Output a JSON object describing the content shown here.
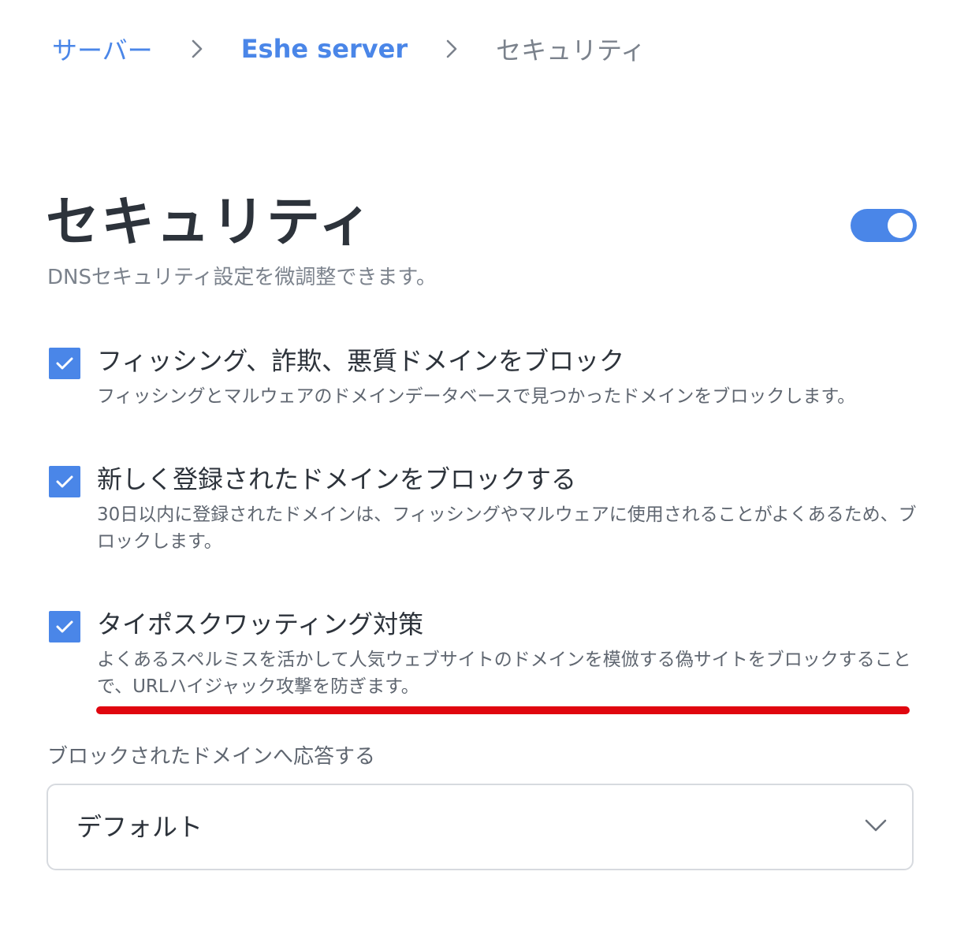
{
  "breadcrumb": {
    "items": [
      "サーバー",
      "Eshe server"
    ],
    "current": "セキュリティ",
    "separator_icon": "chevron-right-icon"
  },
  "header": {
    "title": "セキュリティ",
    "subtitle": "DNSセキュリティ設定を微調整できます。",
    "toggle_enabled": true
  },
  "options": [
    {
      "checked": true,
      "title": "フィッシング、詐欺、悪質ドメインをブロック",
      "description": "フィッシングとマルウェアのドメインデータベースで見つかったドメインをブロックします。"
    },
    {
      "checked": true,
      "title": "新しく登録されたドメインをブロックする",
      "description": "30日以内に登録されたドメインは、フィッシングやマルウェアに使用されることがよくあるため、ブロックします。"
    },
    {
      "checked": true,
      "title": "タイポスクワッティング対策",
      "description": "よくあるスペルミスを活かして人気ウェブサイトのドメインを模倣する偽サイトをブロックすることで、URLハイジャック攻撃を防ぎます。"
    }
  ],
  "response": {
    "label": "ブロックされたドメインへ応答する",
    "selected": "デフォルト",
    "icon": "chevron-down-icon"
  },
  "colors": {
    "accent": "#4a86e8",
    "title_text": "#2d333b",
    "muted_text": "#7b828c",
    "highlight_underline": "#e0060f",
    "border": "#d7dadf"
  }
}
